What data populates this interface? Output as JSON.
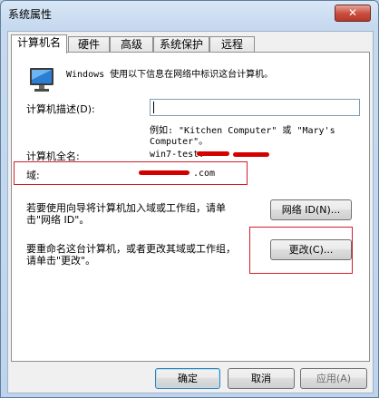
{
  "window": {
    "title": "系统属性",
    "close_glyph": "✕"
  },
  "tabs": [
    {
      "label": "计算机名",
      "active": true
    },
    {
      "label": "硬件",
      "active": false
    },
    {
      "label": "高级",
      "active": false
    },
    {
      "label": "系统保护",
      "active": false
    },
    {
      "label": "远程",
      "active": false
    }
  ],
  "panel": {
    "intro": "Windows 使用以下信息在网络中标识这台计算机。",
    "description_label": "计算机描述(D):",
    "description_value": "",
    "example_line1": "例如: \"Kitchen Computer\" 或 \"Mary's",
    "example_line2": "Computer\"。",
    "full_name_label": "计算机全名:",
    "full_name_value": "win7-test.",
    "domain_label": "域:",
    "domain_value": ".com",
    "network_text_line1": "若要使用向导将计算机加入域或工作组，请单",
    "network_text_line2": "击\"网络 ID\"。",
    "network_button": "网络 ID(N)...",
    "rename_text_line1": "要重命名这台计算机，或者更改其域或工作组，",
    "rename_text_line2": "请单击\"更改\"。",
    "change_button": "更改(C)..."
  },
  "footer": {
    "ok": "确定",
    "cancel": "取消",
    "apply": "应用(A)"
  },
  "colors": {
    "highlight_box": "#d21f2a",
    "redaction": "#d40000",
    "title_bar": "#c6d9ef"
  },
  "icons": {
    "computer": "monitor-icon",
    "close": "close-icon"
  }
}
